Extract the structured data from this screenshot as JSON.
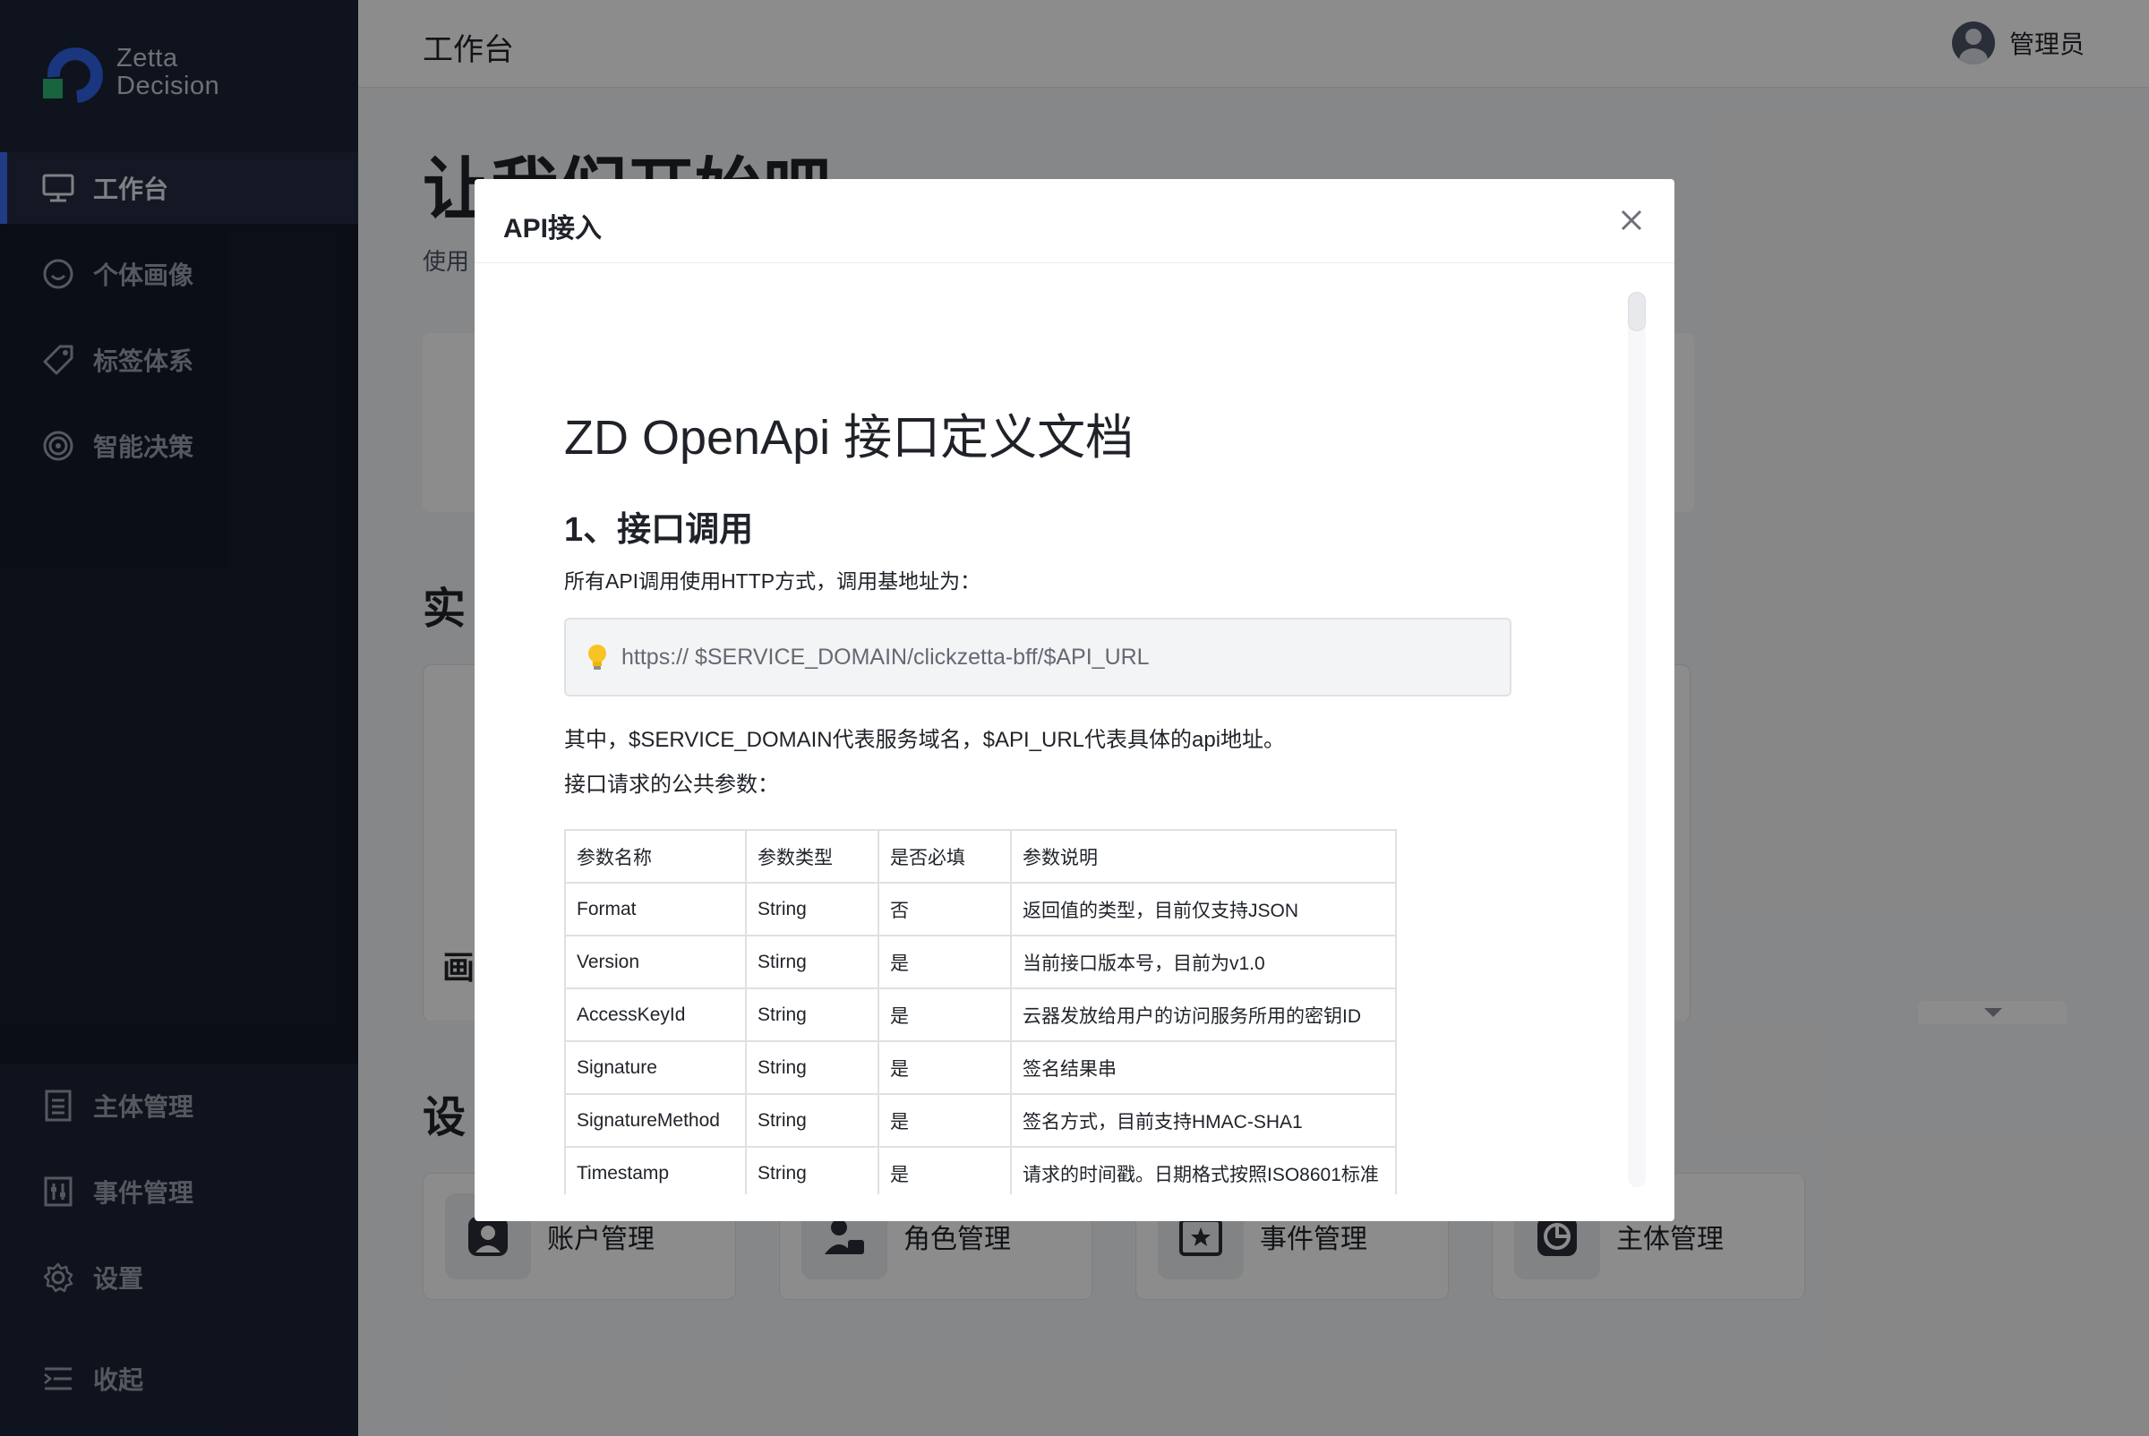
{
  "brand": {
    "name_line1": "Zetta",
    "name_line2": "Decision"
  },
  "sidebar": {
    "top_items": [
      {
        "label": "工作台",
        "icon": "monitor-icon",
        "active": true
      },
      {
        "label": "个体画像",
        "icon": "smile-icon",
        "active": false
      },
      {
        "label": "标签体系",
        "icon": "tag-icon",
        "active": false
      },
      {
        "label": "智能决策",
        "icon": "target-icon",
        "active": false
      }
    ],
    "bottom_items": [
      {
        "label": "主体管理",
        "icon": "list-icon"
      },
      {
        "label": "事件管理",
        "icon": "event-icon"
      },
      {
        "label": "设置",
        "icon": "gear-icon"
      }
    ],
    "collapse_label": "收起"
  },
  "header": {
    "title": "工作台",
    "user_name": "管理员"
  },
  "background": {
    "hero_title": "让我们开始吧",
    "hero_sub": "使用",
    "section_1": "实",
    "card_label": "画",
    "section_2": "设",
    "quick_actions": [
      {
        "label": "账户管理",
        "icon": "account-icon"
      },
      {
        "label": "角色管理",
        "icon": "role-icon"
      },
      {
        "label": "事件管理",
        "icon": "event-star-icon"
      },
      {
        "label": "主体管理",
        "icon": "pie-icon"
      }
    ]
  },
  "modal": {
    "title": "API接入",
    "doc_title": "ZD OpenApi 接口定义文档",
    "section_heading": "1、接口调用",
    "intro": "所有API调用使用HTTP方式，调用基地址为：",
    "base_url": "https:// $SERVICE_DOMAIN/clickzetta-bff/$API_URL",
    "explain": "其中，$SERVICE_DOMAIN代表服务域名，$API_URL代表具体的api地址。",
    "params_intro": "接口请求的公共参数：",
    "table": {
      "headers": [
        "参数名称",
        "参数类型",
        "是否必填",
        "参数说明"
      ],
      "rows": [
        [
          "Format",
          "String",
          "否",
          "返回值的类型，目前仅支持JSON"
        ],
        [
          "Version",
          "Stirng",
          "是",
          "当前接口版本号，目前为v1.0"
        ],
        [
          "AccessKeyId",
          "String",
          "是",
          "云器发放给用户的访问服务所用的密钥ID"
        ],
        [
          "Signature",
          "String",
          "是",
          "签名结果串"
        ],
        [
          "SignatureMethod",
          "String",
          "是",
          "签名方式，目前支持HMAC-SHA1"
        ],
        [
          "Timestamp",
          "String",
          "是",
          "请求的时间戳。日期格式按照ISO8601标准"
        ]
      ]
    }
  }
}
